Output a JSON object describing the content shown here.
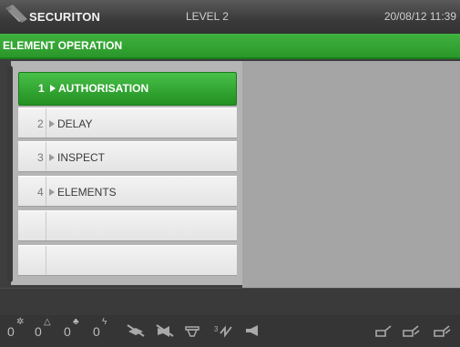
{
  "header": {
    "brand": "SECURITON",
    "level": "LEVEL 2",
    "datetime": "20/08/12 11:39"
  },
  "title": "ELEMENT OPERATION",
  "menu": {
    "items": [
      {
        "num": "1",
        "label": "AUTHORISATION",
        "active": true
      },
      {
        "num": "2",
        "label": "DELAY",
        "active": false
      },
      {
        "num": "3",
        "label": "INSPECT",
        "active": false
      },
      {
        "num": "4",
        "label": "ELEMENTS",
        "active": false
      },
      {
        "num": "",
        "label": "",
        "active": false
      },
      {
        "num": "",
        "label": "",
        "active": false
      }
    ]
  },
  "status": {
    "counters": [
      {
        "value": "0",
        "icon": "fire-icon"
      },
      {
        "value": "0",
        "icon": "warning-icon"
      },
      {
        "value": "0",
        "icon": "person-icon"
      },
      {
        "value": "0",
        "icon": "fault-icon"
      }
    ],
    "symbols": [
      "disabled-detector-icon",
      "disabled-sounder-icon",
      "test-icon",
      "delay-icon",
      "horn-icon",
      "key-icon-1",
      "key-icon-2",
      "key-icon-3"
    ]
  }
}
